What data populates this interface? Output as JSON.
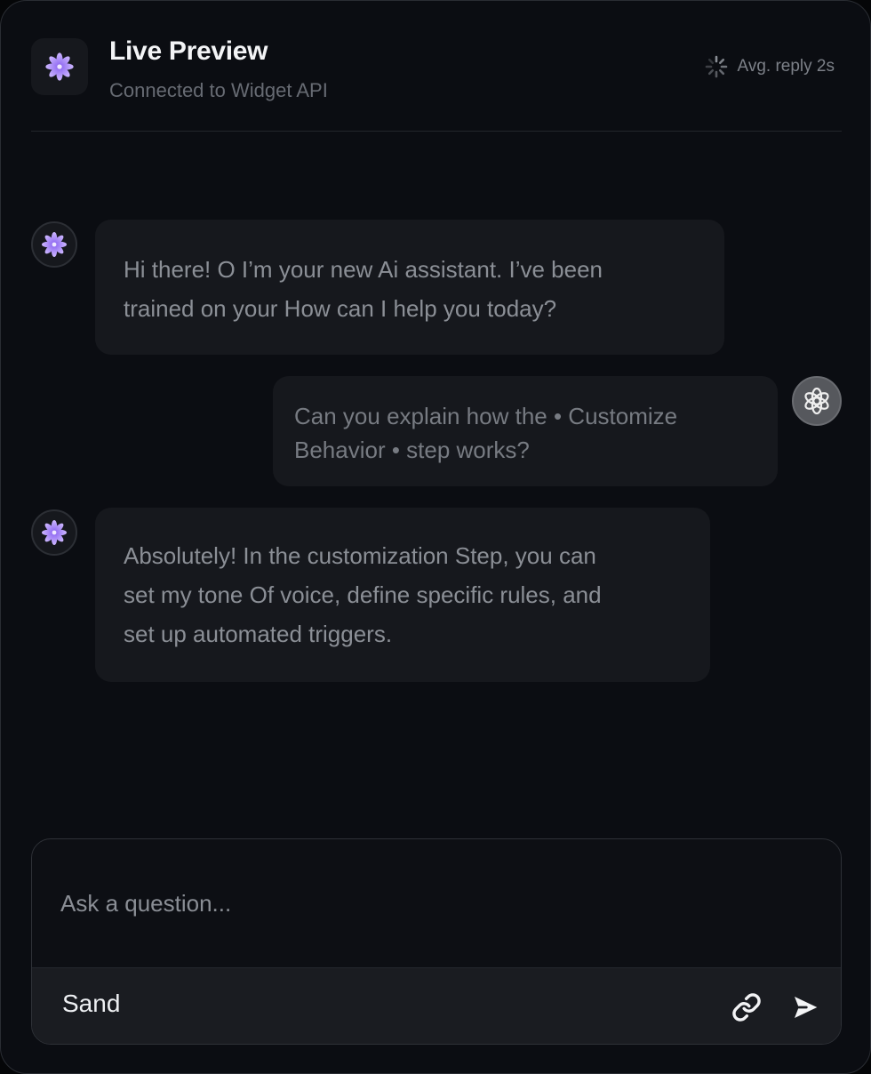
{
  "header": {
    "title": "Live Preview",
    "subtitle": "Connected to Widget API",
    "status_text": "Avg. reply 2s",
    "logo_icon": "sparkle-flower-icon",
    "status_icon": "spinner-icon"
  },
  "messages": [
    {
      "role": "assistant",
      "avatar_icon": "sparkle-flower-icon",
      "lines": [
        "Hi there! O I’m your new Ai assistant. I’ve been",
        "trained on your How can I help you today?"
      ]
    },
    {
      "role": "user",
      "avatar_icon": "openai-knot-icon",
      "lines": [
        "Can you explain how the  • Customize",
        "Behavior •  step works?"
      ]
    },
    {
      "role": "assistant",
      "avatar_icon": "sparkle-flower-icon",
      "lines": [
        "Absolutely! In the customization Step, you can",
        "set my tone Of voice, define specific rules, and",
        "set up automated triggers."
      ]
    }
  ],
  "composer": {
    "placeholder": "Ask a question...",
    "value": "",
    "send_label": "Sand",
    "attach_icon": "link-icon",
    "send_icon": "send-arrow-icon"
  },
  "colors": {
    "background": "#0b0d12",
    "bubble": "#16181d",
    "accent_petal": "#b89cff",
    "text_primary": "#f3f4f6",
    "text_muted": "#8b8f96"
  }
}
